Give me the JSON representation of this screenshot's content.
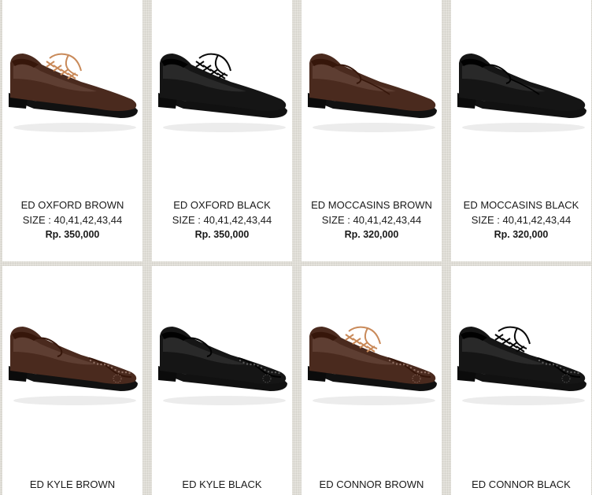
{
  "products": [
    {
      "name": "ED OXFORD BROWN",
      "size": "SIZE : 40,41,42,43,44",
      "price": "Rp. 350,000",
      "color": "#4a2a1e",
      "lace_color": "#c98a5a",
      "style": "oxford",
      "shoe_icon": "oxford-shoe-icon"
    },
    {
      "name": "ED OXFORD BLACK",
      "size": "SIZE : 40,41,42,43,44",
      "price": "Rp. 350,000",
      "color": "#151515",
      "lace_color": "#0a0a0a",
      "style": "oxford",
      "shoe_icon": "oxford-shoe-icon"
    },
    {
      "name": "ED MOCCASINS BROWN",
      "size": "SIZE : 40,41,42,43,44",
      "price": "Rp. 320,000",
      "color": "#4a2a1e",
      "lace_color": "",
      "style": "moccasin",
      "shoe_icon": "moccasin-shoe-icon"
    },
    {
      "name": "ED MOCCASINS BLACK",
      "size": "SIZE : 40,41,42,43,44",
      "price": "Rp. 320,000",
      "color": "#151515",
      "lace_color": "",
      "style": "moccasin",
      "shoe_icon": "moccasin-shoe-icon"
    },
    {
      "name": "ED KYLE BROWN",
      "size": "",
      "price": "",
      "color": "#4a2a1e",
      "lace_color": "",
      "style": "kyle",
      "shoe_icon": "brogue-slipon-shoe-icon"
    },
    {
      "name": "ED KYLE BLACK",
      "size": "",
      "price": "",
      "color": "#151515",
      "lace_color": "",
      "style": "kyle",
      "shoe_icon": "brogue-slipon-shoe-icon"
    },
    {
      "name": "ED CONNOR BROWN",
      "size": "",
      "price": "",
      "color": "#4a2a1e",
      "lace_color": "#c98a5a",
      "style": "connor",
      "shoe_icon": "brogue-lace-shoe-icon"
    },
    {
      "name": "ED CONNOR BLACK",
      "size": "",
      "price": "",
      "color": "#151515",
      "lace_color": "#0a0a0a",
      "style": "connor",
      "shoe_icon": "brogue-lace-shoe-icon"
    }
  ]
}
